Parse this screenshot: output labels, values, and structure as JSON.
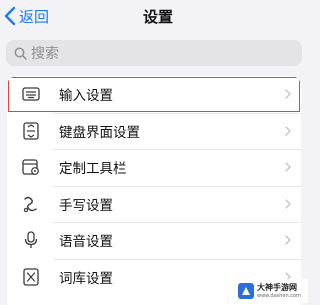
{
  "nav": {
    "back_label": "返回",
    "title": "设置"
  },
  "search": {
    "placeholder": "搜索"
  },
  "settings": [
    {
      "label": "输入设置",
      "icon": "keyboard-icon",
      "selected": true
    },
    {
      "label": "键盘界面设置",
      "icon": "keyboard-layout-icon",
      "selected": false
    },
    {
      "label": "定制工具栏",
      "icon": "toolbar-icon",
      "selected": false
    },
    {
      "label": "手写设置",
      "icon": "handwriting-icon",
      "selected": false
    },
    {
      "label": "语音设置",
      "icon": "microphone-icon",
      "selected": false
    },
    {
      "label": "词库设置",
      "icon": "dictionary-icon",
      "selected": false
    }
  ],
  "watermark": {
    "title": "大神手游网",
    "subtitle": "www.dashen.com"
  },
  "colors": {
    "accent": "#1a7cf5",
    "highlight": "#e0413b",
    "icon": "#3a3a3c"
  }
}
